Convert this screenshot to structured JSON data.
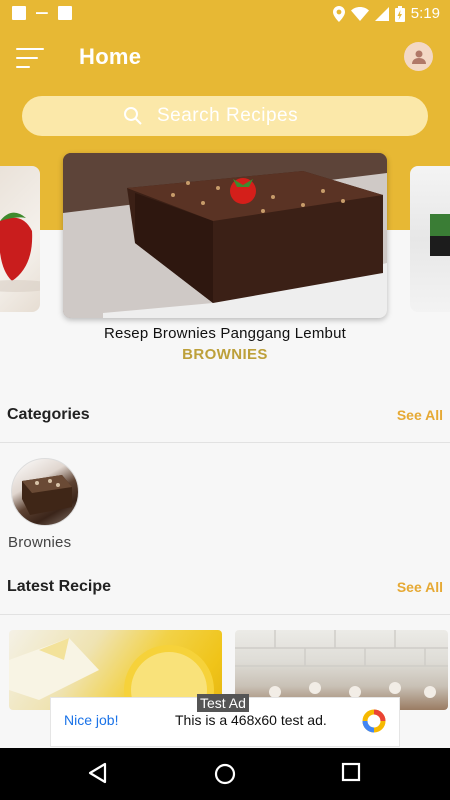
{
  "status_bar": {
    "time": "5:19"
  },
  "header": {
    "title": "Home"
  },
  "search": {
    "placeholder": "Search Recipes"
  },
  "featured": {
    "title": "Resep Brownies Panggang Lembut",
    "category": "BROWNIES"
  },
  "categories_section": {
    "title": "Categories",
    "see_all": "See All",
    "items": [
      {
        "label": "Brownies"
      }
    ]
  },
  "latest_section": {
    "title": "Latest Recipe",
    "see_all": "See All"
  },
  "ad": {
    "badge": "Test Ad",
    "headline": "Nice job!",
    "text": "This is a 468x60 test ad."
  },
  "colors": {
    "primary": "#e7b834",
    "accent": "#e6a934",
    "category_text": "#bda03a"
  },
  "icons": {
    "menu": "menu-icon",
    "avatar": "user-icon",
    "search": "search-icon",
    "back": "back-triangle-icon",
    "home": "home-circle-icon",
    "recents": "recents-square-icon"
  }
}
